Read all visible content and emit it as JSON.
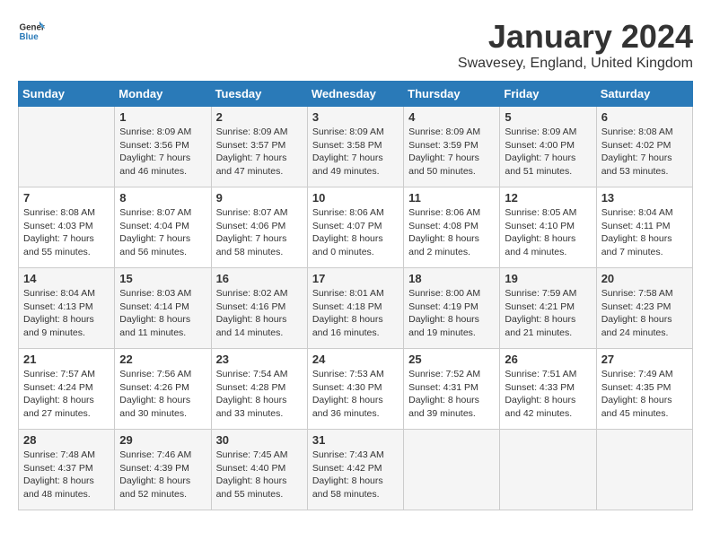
{
  "logo": {
    "text_general": "General",
    "text_blue": "Blue"
  },
  "title": "January 2024",
  "location": "Swavesey, England, United Kingdom",
  "days_of_week": [
    "Sunday",
    "Monday",
    "Tuesday",
    "Wednesday",
    "Thursday",
    "Friday",
    "Saturday"
  ],
  "weeks": [
    [
      {
        "day": "",
        "info": ""
      },
      {
        "day": "1",
        "info": "Sunrise: 8:09 AM\nSunset: 3:56 PM\nDaylight: 7 hours\nand 46 minutes."
      },
      {
        "day": "2",
        "info": "Sunrise: 8:09 AM\nSunset: 3:57 PM\nDaylight: 7 hours\nand 47 minutes."
      },
      {
        "day": "3",
        "info": "Sunrise: 8:09 AM\nSunset: 3:58 PM\nDaylight: 7 hours\nand 49 minutes."
      },
      {
        "day": "4",
        "info": "Sunrise: 8:09 AM\nSunset: 3:59 PM\nDaylight: 7 hours\nand 50 minutes."
      },
      {
        "day": "5",
        "info": "Sunrise: 8:09 AM\nSunset: 4:00 PM\nDaylight: 7 hours\nand 51 minutes."
      },
      {
        "day": "6",
        "info": "Sunrise: 8:08 AM\nSunset: 4:02 PM\nDaylight: 7 hours\nand 53 minutes."
      }
    ],
    [
      {
        "day": "7",
        "info": "Sunrise: 8:08 AM\nSunset: 4:03 PM\nDaylight: 7 hours\nand 55 minutes."
      },
      {
        "day": "8",
        "info": "Sunrise: 8:07 AM\nSunset: 4:04 PM\nDaylight: 7 hours\nand 56 minutes."
      },
      {
        "day": "9",
        "info": "Sunrise: 8:07 AM\nSunset: 4:06 PM\nDaylight: 7 hours\nand 58 minutes."
      },
      {
        "day": "10",
        "info": "Sunrise: 8:06 AM\nSunset: 4:07 PM\nDaylight: 8 hours\nand 0 minutes."
      },
      {
        "day": "11",
        "info": "Sunrise: 8:06 AM\nSunset: 4:08 PM\nDaylight: 8 hours\nand 2 minutes."
      },
      {
        "day": "12",
        "info": "Sunrise: 8:05 AM\nSunset: 4:10 PM\nDaylight: 8 hours\nand 4 minutes."
      },
      {
        "day": "13",
        "info": "Sunrise: 8:04 AM\nSunset: 4:11 PM\nDaylight: 8 hours\nand 7 minutes."
      }
    ],
    [
      {
        "day": "14",
        "info": "Sunrise: 8:04 AM\nSunset: 4:13 PM\nDaylight: 8 hours\nand 9 minutes."
      },
      {
        "day": "15",
        "info": "Sunrise: 8:03 AM\nSunset: 4:14 PM\nDaylight: 8 hours\nand 11 minutes."
      },
      {
        "day": "16",
        "info": "Sunrise: 8:02 AM\nSunset: 4:16 PM\nDaylight: 8 hours\nand 14 minutes."
      },
      {
        "day": "17",
        "info": "Sunrise: 8:01 AM\nSunset: 4:18 PM\nDaylight: 8 hours\nand 16 minutes."
      },
      {
        "day": "18",
        "info": "Sunrise: 8:00 AM\nSunset: 4:19 PM\nDaylight: 8 hours\nand 19 minutes."
      },
      {
        "day": "19",
        "info": "Sunrise: 7:59 AM\nSunset: 4:21 PM\nDaylight: 8 hours\nand 21 minutes."
      },
      {
        "day": "20",
        "info": "Sunrise: 7:58 AM\nSunset: 4:23 PM\nDaylight: 8 hours\nand 24 minutes."
      }
    ],
    [
      {
        "day": "21",
        "info": "Sunrise: 7:57 AM\nSunset: 4:24 PM\nDaylight: 8 hours\nand 27 minutes."
      },
      {
        "day": "22",
        "info": "Sunrise: 7:56 AM\nSunset: 4:26 PM\nDaylight: 8 hours\nand 30 minutes."
      },
      {
        "day": "23",
        "info": "Sunrise: 7:54 AM\nSunset: 4:28 PM\nDaylight: 8 hours\nand 33 minutes."
      },
      {
        "day": "24",
        "info": "Sunrise: 7:53 AM\nSunset: 4:30 PM\nDaylight: 8 hours\nand 36 minutes."
      },
      {
        "day": "25",
        "info": "Sunrise: 7:52 AM\nSunset: 4:31 PM\nDaylight: 8 hours\nand 39 minutes."
      },
      {
        "day": "26",
        "info": "Sunrise: 7:51 AM\nSunset: 4:33 PM\nDaylight: 8 hours\nand 42 minutes."
      },
      {
        "day": "27",
        "info": "Sunrise: 7:49 AM\nSunset: 4:35 PM\nDaylight: 8 hours\nand 45 minutes."
      }
    ],
    [
      {
        "day": "28",
        "info": "Sunrise: 7:48 AM\nSunset: 4:37 PM\nDaylight: 8 hours\nand 48 minutes."
      },
      {
        "day": "29",
        "info": "Sunrise: 7:46 AM\nSunset: 4:39 PM\nDaylight: 8 hours\nand 52 minutes."
      },
      {
        "day": "30",
        "info": "Sunrise: 7:45 AM\nSunset: 4:40 PM\nDaylight: 8 hours\nand 55 minutes."
      },
      {
        "day": "31",
        "info": "Sunrise: 7:43 AM\nSunset: 4:42 PM\nDaylight: 8 hours\nand 58 minutes."
      },
      {
        "day": "",
        "info": ""
      },
      {
        "day": "",
        "info": ""
      },
      {
        "day": "",
        "info": ""
      }
    ]
  ]
}
